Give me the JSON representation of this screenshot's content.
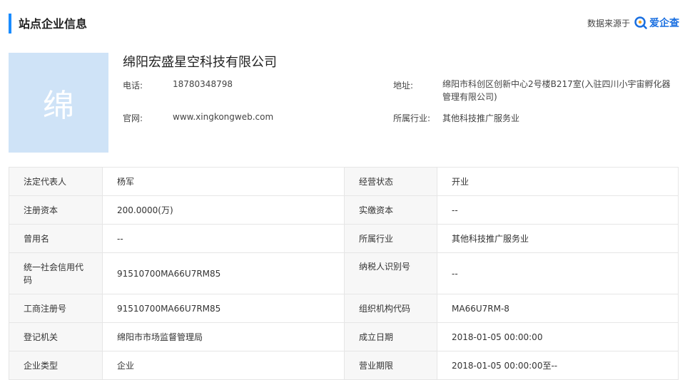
{
  "header": {
    "title": "站点企业信息",
    "source_prefix": "数据来源于",
    "source_brand": "爱企查",
    "brand_color": "#1a6fe0"
  },
  "company": {
    "logo_char": "绵",
    "name": "绵阳宏盛星空科技有限公司",
    "phone_label": "电话:",
    "phone": "18780348798",
    "website_label": "官网:",
    "website": "www.xingkongweb.com",
    "address_label": "地址:",
    "address": "绵阳市科创区创新中心2号楼B217室(入驻四川小宇宙孵化器管理有限公司)",
    "industry_label": "所属行业:",
    "industry": "其他科技推广服务业"
  },
  "table": {
    "rows": [
      {
        "l1": "法定代表人",
        "v1": "杨军",
        "l2": "经营状态",
        "v2": "开业"
      },
      {
        "l1": "注册资本",
        "v1": "200.0000(万)",
        "l2": "实缴资本",
        "v2": "--"
      },
      {
        "l1": "曾用名",
        "v1": "--",
        "l2": "所属行业",
        "v2": "其他科技推广服务业"
      },
      {
        "l1": "统一社会信用代码",
        "v1": "91510700MA66U7RM85",
        "l2": "纳税人识别号",
        "v2": "--"
      },
      {
        "l1": "工商注册号",
        "v1": "91510700MA66U7RM85",
        "l2": "组织机构代码",
        "v2": "MA66U7RM-8"
      },
      {
        "l1": "登记机关",
        "v1": "绵阳市市场监督管理局",
        "l2": "成立日期",
        "v2": "2018-01-05 00:00:00"
      },
      {
        "l1": "企业类型",
        "v1": "企业",
        "l2": "营业期限",
        "v2": "2018-01-05 00:00:00至--"
      }
    ]
  }
}
